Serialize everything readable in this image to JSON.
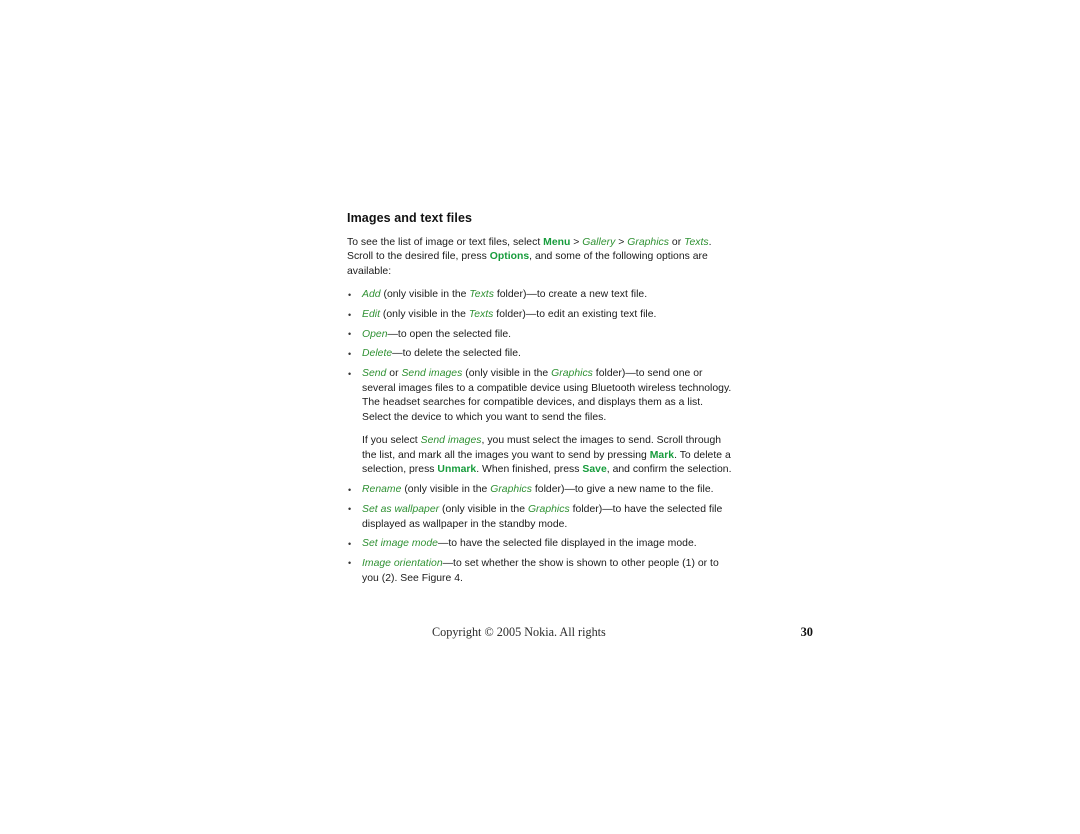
{
  "page": {
    "heading": "Images and text files",
    "intro": {
      "seg1": "To see the list of image or text files, select ",
      "key_menu": "Menu",
      "sep1": " > ",
      "item_gallery": "Gallery",
      "sep2": " > ",
      "item_graphics": "Graphics",
      "seg2": " or ",
      "item_texts": "Texts",
      "seg3": ". Scroll to the desired file, press ",
      "key_options": "Options",
      "seg4": ", and some of the following options are available:"
    },
    "bullets": [
      {
        "term": "Add",
        "mid1": " (only visible in the ",
        "folder": "Texts",
        "mid2": " folder)—to create a new text file.",
        "tail": ""
      },
      {
        "term": "Edit",
        "mid1": " (only visible in the ",
        "folder": "Texts",
        "mid2": " folder)—to edit an existing text file.",
        "tail": ""
      },
      {
        "term": "Open",
        "mid1": "—to open the selected file.",
        "folder": "",
        "mid2": "",
        "tail": ""
      },
      {
        "term": "Delete",
        "mid1": "—to delete the selected file.",
        "folder": "",
        "mid2": "",
        "tail": ""
      },
      {
        "term": "Rename",
        "mid1": " (only visible in the ",
        "folder": "Graphics",
        "mid2": " folder)—to give a new name to the file.",
        "tail": ""
      },
      {
        "term": "Set as wallpaper",
        "mid1": " (only visible in the ",
        "folder": "Graphics",
        "mid2": " folder)—to have the selected file displayed as wallpaper in the standby mode.",
        "tail": ""
      },
      {
        "term": "Set image mode",
        "mid1": "—to have the selected file displayed in the image mode.",
        "folder": "",
        "mid2": "",
        "tail": ""
      },
      {
        "term": "Image orientation",
        "mid1": "—to set whether the show is shown to other people (1) or to you (2). See Figure 4.",
        "folder": "",
        "mid2": "",
        "tail": ""
      }
    ],
    "send_bullet": {
      "term1": "Send",
      "conj": " or ",
      "term2": "Send images",
      "mid1": " (only visible in the ",
      "folder": "Graphics",
      "mid2": " folder)—to send one or several images files to a compatible device using Bluetooth wireless technology. The headset searches for compatible devices, and displays them as a list. Select the device to which you want to send the files."
    },
    "send_subparagraph": {
      "seg1": "If you select ",
      "term": "Send images",
      "seg2": ", you must select the images to send. Scroll through the list, and mark all the images you want to send by pressing ",
      "key_mark": "Mark",
      "seg3": ". To delete a selection, press ",
      "key_unmark": "Unmark",
      "seg4": ". When finished, press ",
      "key_save": "Save",
      "seg5": ", and confirm the selection."
    },
    "footer": {
      "copyright": "Copyright © 2005 Nokia. All rights",
      "page_number": "30"
    },
    "colors": {
      "accent_green_italic": "#2f9133",
      "accent_green_key": "#179c3c",
      "body_text": "#1a1a1a",
      "background": "#ffffff"
    }
  }
}
